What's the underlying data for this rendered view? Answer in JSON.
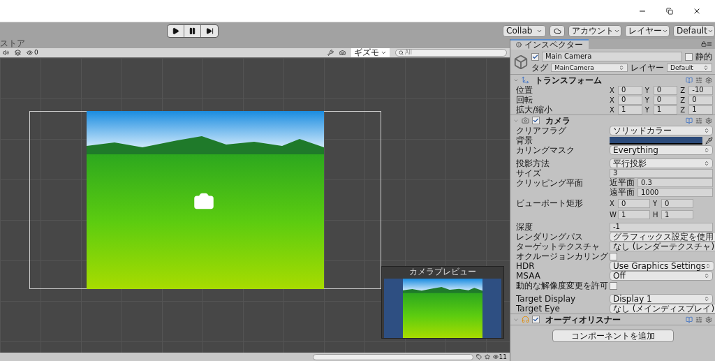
{
  "toolbar": {
    "collab": "Collab",
    "account": "アカウント",
    "layers": "レイヤー",
    "layout": "Default"
  },
  "scene": {
    "tab_label": "ストア",
    "hidden_count": "0",
    "gizmos": "ギズモ",
    "search_placeholder": "All",
    "preview_title": "カメラプレビュー",
    "layer_count": "11"
  },
  "inspector": {
    "tab": "インスペクター",
    "object": {
      "active": true,
      "name": "Main Camera",
      "static": false,
      "static_label": "静的",
      "tag_label": "タグ",
      "tag": "MainCamera",
      "layer_label": "レイヤー",
      "layer": "Default"
    },
    "components": [
      {
        "kind": "transform",
        "title": "トランスフォーム",
        "groups": [
          [
            {
              "kind": "xyz",
              "label": "位置",
              "values": [
                {
                  "axis": "X",
                  "value": "0"
                },
                {
                  "axis": "Y",
                  "value": "0"
                },
                {
                  "axis": "Z",
                  "value": "-10"
                }
              ]
            },
            {
              "kind": "xyz",
              "label": "回転",
              "values": [
                {
                  "axis": "X",
                  "value": "0"
                },
                {
                  "axis": "Y",
                  "value": "0"
                },
                {
                  "axis": "Z",
                  "value": "0"
                }
              ]
            },
            {
              "kind": "xyz",
              "label": "拡大/縮小",
              "values": [
                {
                  "axis": "X",
                  "value": "1"
                },
                {
                  "axis": "Y",
                  "value": "1"
                },
                {
                  "axis": "Z",
                  "value": "1"
                }
              ]
            }
          ]
        ]
      },
      {
        "kind": "camera",
        "title": "カメラ",
        "enabled": true,
        "groups": [
          [
            {
              "kind": "dropdown",
              "label": "クリアフラグ",
              "value": "ソリッドカラー"
            },
            {
              "kind": "color",
              "label": "背景",
              "color": "#2b4a7a"
            },
            {
              "kind": "dropdown",
              "label": "カリングマスク",
              "value": "Everything"
            }
          ],
          [
            {
              "kind": "dropdown",
              "label": "投影方法",
              "value": "平行投影"
            },
            {
              "kind": "text",
              "label": "サイズ",
              "value": "3"
            },
            {
              "kind": "clip",
              "label": "クリッピング平面",
              "values": [
                {
                  "axis": "近平面",
                  "value": "0.3"
                },
                {
                  "axis": "遠平面",
                  "value": "1000"
                }
              ]
            },
            {
              "kind": "xywh",
              "label": "ビューポート矩形",
              "values": [
                {
                  "axis": "X",
                  "value": "0"
                },
                {
                  "axis": "Y",
                  "value": "0"
                },
                {
                  "axis": "W",
                  "value": "1"
                },
                {
                  "axis": "H",
                  "value": "1"
                }
              ]
            }
          ],
          [
            {
              "kind": "text",
              "label": "深度",
              "value": "-1"
            },
            {
              "kind": "dropdown",
              "label": "レンダリングパス",
              "value": "グラフィックス設定を使用"
            },
            {
              "kind": "object",
              "label": "ターゲットテクスチャ",
              "value": "なし (レンダーテクスチャ)"
            },
            {
              "kind": "checkbox",
              "label": "オクルージョンカリング",
              "checked": false
            },
            {
              "kind": "dropdown",
              "label": "HDR",
              "value": "Use Graphics Settings"
            },
            {
              "kind": "dropdown",
              "label": "MSAA",
              "value": "Off"
            },
            {
              "kind": "checkbox",
              "label": "動的な解像度変更を許可",
              "checked": false
            }
          ],
          [
            {
              "kind": "dropdown",
              "label": "Target Display",
              "value": "Display 1"
            },
            {
              "kind": "dropdown",
              "label": "Target Eye",
              "value": "なし (メインディスプレイ)"
            }
          ]
        ]
      },
      {
        "kind": "audio",
        "title": "オーディオリスナー",
        "enabled": true
      }
    ],
    "add_component": "コンポーネントを追加"
  }
}
